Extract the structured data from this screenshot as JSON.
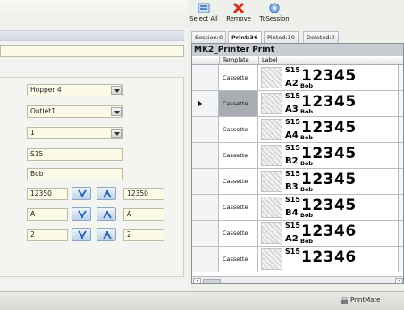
{
  "toolbar": {
    "select_all": "Select All",
    "remove": "Remove",
    "to_session": "ToSession"
  },
  "tabs": [
    "Session:0",
    "Print:36",
    "Pinted:10",
    "Deleted:0"
  ],
  "grid": {
    "title": "MK2_Printer Print",
    "columns": [
      "Template",
      "Label"
    ],
    "rows": [
      {
        "template": "Cassette",
        "small": "S15",
        "big": "12345",
        "bottom": "A2",
        "name": "Bob"
      },
      {
        "template": "Cassette",
        "small": "S15",
        "big": "12345",
        "bottom": "A3",
        "name": "Bob"
      },
      {
        "template": "Cassette",
        "small": "S15",
        "big": "12345",
        "bottom": "A4",
        "name": "Bob"
      },
      {
        "template": "Cassette",
        "small": "S15",
        "big": "12345",
        "bottom": "B2",
        "name": "Bob"
      },
      {
        "template": "Cassette",
        "small": "S15",
        "big": "12345",
        "bottom": "B3",
        "name": "Bob"
      },
      {
        "template": "Cassette",
        "small": "S15",
        "big": "12345",
        "bottom": "B4",
        "name": "Bob"
      },
      {
        "template": "Cassette",
        "small": "S15",
        "big": "12346",
        "bottom": "A2",
        "name": "Bob"
      },
      {
        "template": "Cassette",
        "small": "S15",
        "big": "12346",
        "bottom": "",
        "name": ""
      }
    ],
    "current_row": 1
  },
  "form": {
    "hopper": "Hopper 4",
    "outlet": "Outlet1",
    "count": "1",
    "slide": "S15",
    "name": "Bob",
    "range1": {
      "value": "12350",
      "end": "12350"
    },
    "range2": {
      "value": "A",
      "end": "A"
    },
    "range3": {
      "value": "2",
      "end": "2"
    }
  },
  "status": {
    "app": "PrintMate"
  },
  "colors": {
    "accent": "#4f88c6",
    "remove_red": "#d6301f",
    "field_bg": "#fbfae6"
  }
}
